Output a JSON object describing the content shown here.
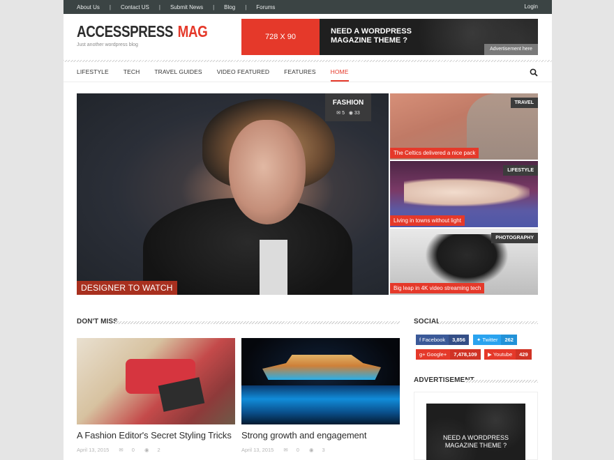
{
  "topbar": {
    "links": [
      "About Us",
      "Contact US",
      "Submit News",
      "Blog",
      "Forums"
    ],
    "separator": "|",
    "login": "Login"
  },
  "header": {
    "logo_part1": "ACCESSPRESS",
    "logo_part2": "MAG",
    "tagline": "Just another wordpress blog",
    "ad_size": "728 X 90",
    "ad_text": "NEED A WORDPRESS MAGAZINE THEME ?",
    "ad_cta": "Advertisement here"
  },
  "nav": {
    "items": [
      "LIFESTYLE",
      "TECH",
      "TRAVEL GUIDES",
      "VIDEO FEATURED",
      "FEATURES",
      "HOME"
    ],
    "active": "HOME"
  },
  "featured": {
    "main": {
      "category": "FASHION",
      "comments": "5",
      "views": "33",
      "title": "DESIGNER TO WATCH"
    },
    "side": [
      {
        "category": "TRAVEL",
        "title": "The Celtics delivered a nice pack"
      },
      {
        "category": "LIFESTYLE",
        "title": "Living in towns without light"
      },
      {
        "category": "PHOTOGRAPHY",
        "title": "Big leap in 4K video streaming tech"
      }
    ]
  },
  "dont_miss": {
    "heading": "DON'T MISS",
    "posts": [
      {
        "title": "A Fashion Editor's Secret Styling Tricks",
        "date": "April 13, 2015",
        "comments": "0",
        "views": "2"
      },
      {
        "title": "Strong growth and engagement",
        "date": "April 13, 2015",
        "comments": "0",
        "views": "3"
      }
    ]
  },
  "social": {
    "heading": "SOCIAL",
    "facebook": {
      "label": "Facebook",
      "count": "3,856"
    },
    "twitter": {
      "label": "Twitter",
      "count": "262"
    },
    "googleplus": {
      "label": "Google+",
      "count": "7,478,109"
    },
    "youtube": {
      "label": "Youtube",
      "count": "429"
    }
  },
  "advertisement": {
    "heading": "ADVERTISEMENT",
    "text": "NEED A WORDPRESS MAGAZINE THEME ?"
  },
  "colors": {
    "accent": "#e5392a",
    "topbar": "#3b4444",
    "facebook": "#3b5998",
    "twitter": "#2aa3ef"
  }
}
